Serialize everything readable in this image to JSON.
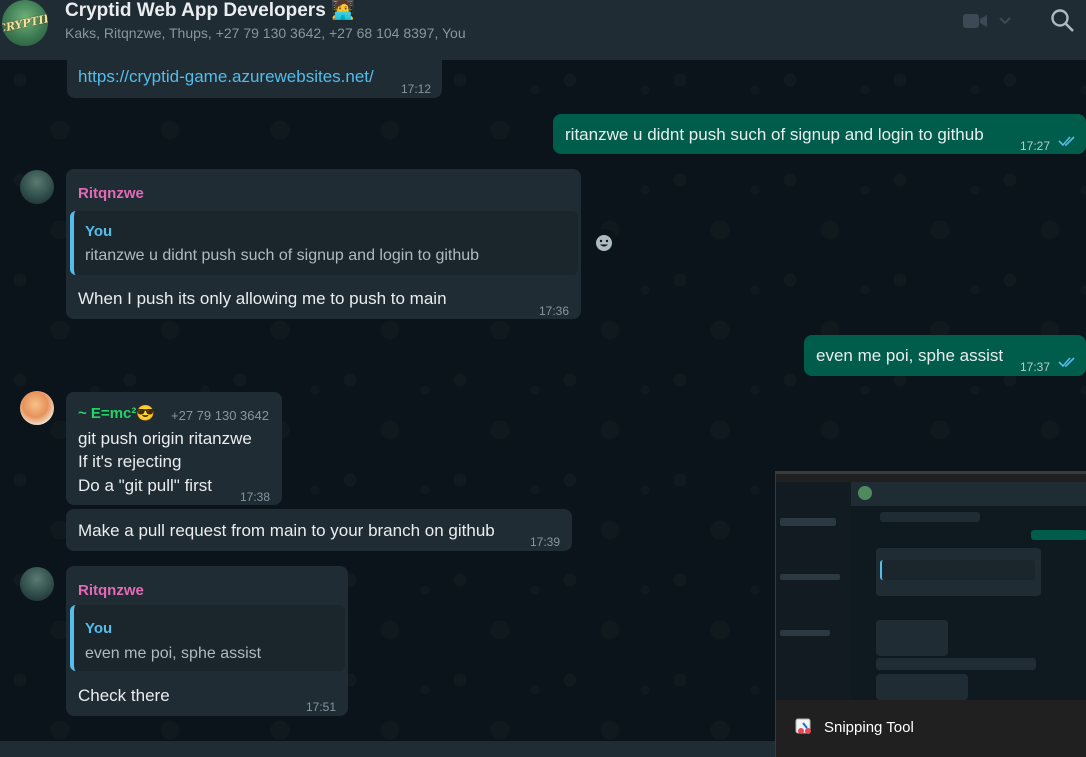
{
  "header": {
    "title": "Cryptid Web App Developers 🧑‍💻",
    "members": "Kaks, Ritqnzwe, Thups, +27 79 130 3642, +27 68 104 8397, You",
    "avatar_text": "CRYPTID"
  },
  "messages": {
    "m1": {
      "link": "https://cryptid-game.azurewebsites.net/",
      "time": "17:12"
    },
    "m2": {
      "text": "ritanzwe u didnt push such of signup and login to github",
      "time": "17:27"
    },
    "m3": {
      "sender": "Ritqnzwe",
      "quote_who": "You",
      "quote_text": "ritanzwe u didnt push such of signup and login to github",
      "text": "When I push its only allowing me to push to main",
      "time": "17:36"
    },
    "m4": {
      "text": "even me poi,  sphe assist",
      "time": "17:37"
    },
    "m5": {
      "sender": "~ E=mc²😎",
      "phone": "+27 79 130 3642",
      "line1": "git push origin ritanzwe",
      "line2": "If it's rejecting",
      "line3": "Do a \"git pull\" first",
      "time": "17:38"
    },
    "m6": {
      "text": "Make a pull request from main to your branch on github",
      "time": "17:39"
    },
    "m7": {
      "sender": "Ritqnzwe",
      "quote_who": "You",
      "quote_text": "even me poi,  sphe assist",
      "text": "Check there",
      "time": "17:51"
    }
  },
  "snipping": {
    "label": "Snipping Tool"
  },
  "colors": {
    "header": "#202c33",
    "incoming": "#202c33",
    "outgoing": "#005c4b",
    "sender_pink": "#e26ab6",
    "sender_green": "#25d366",
    "link": "#53bdeb"
  }
}
